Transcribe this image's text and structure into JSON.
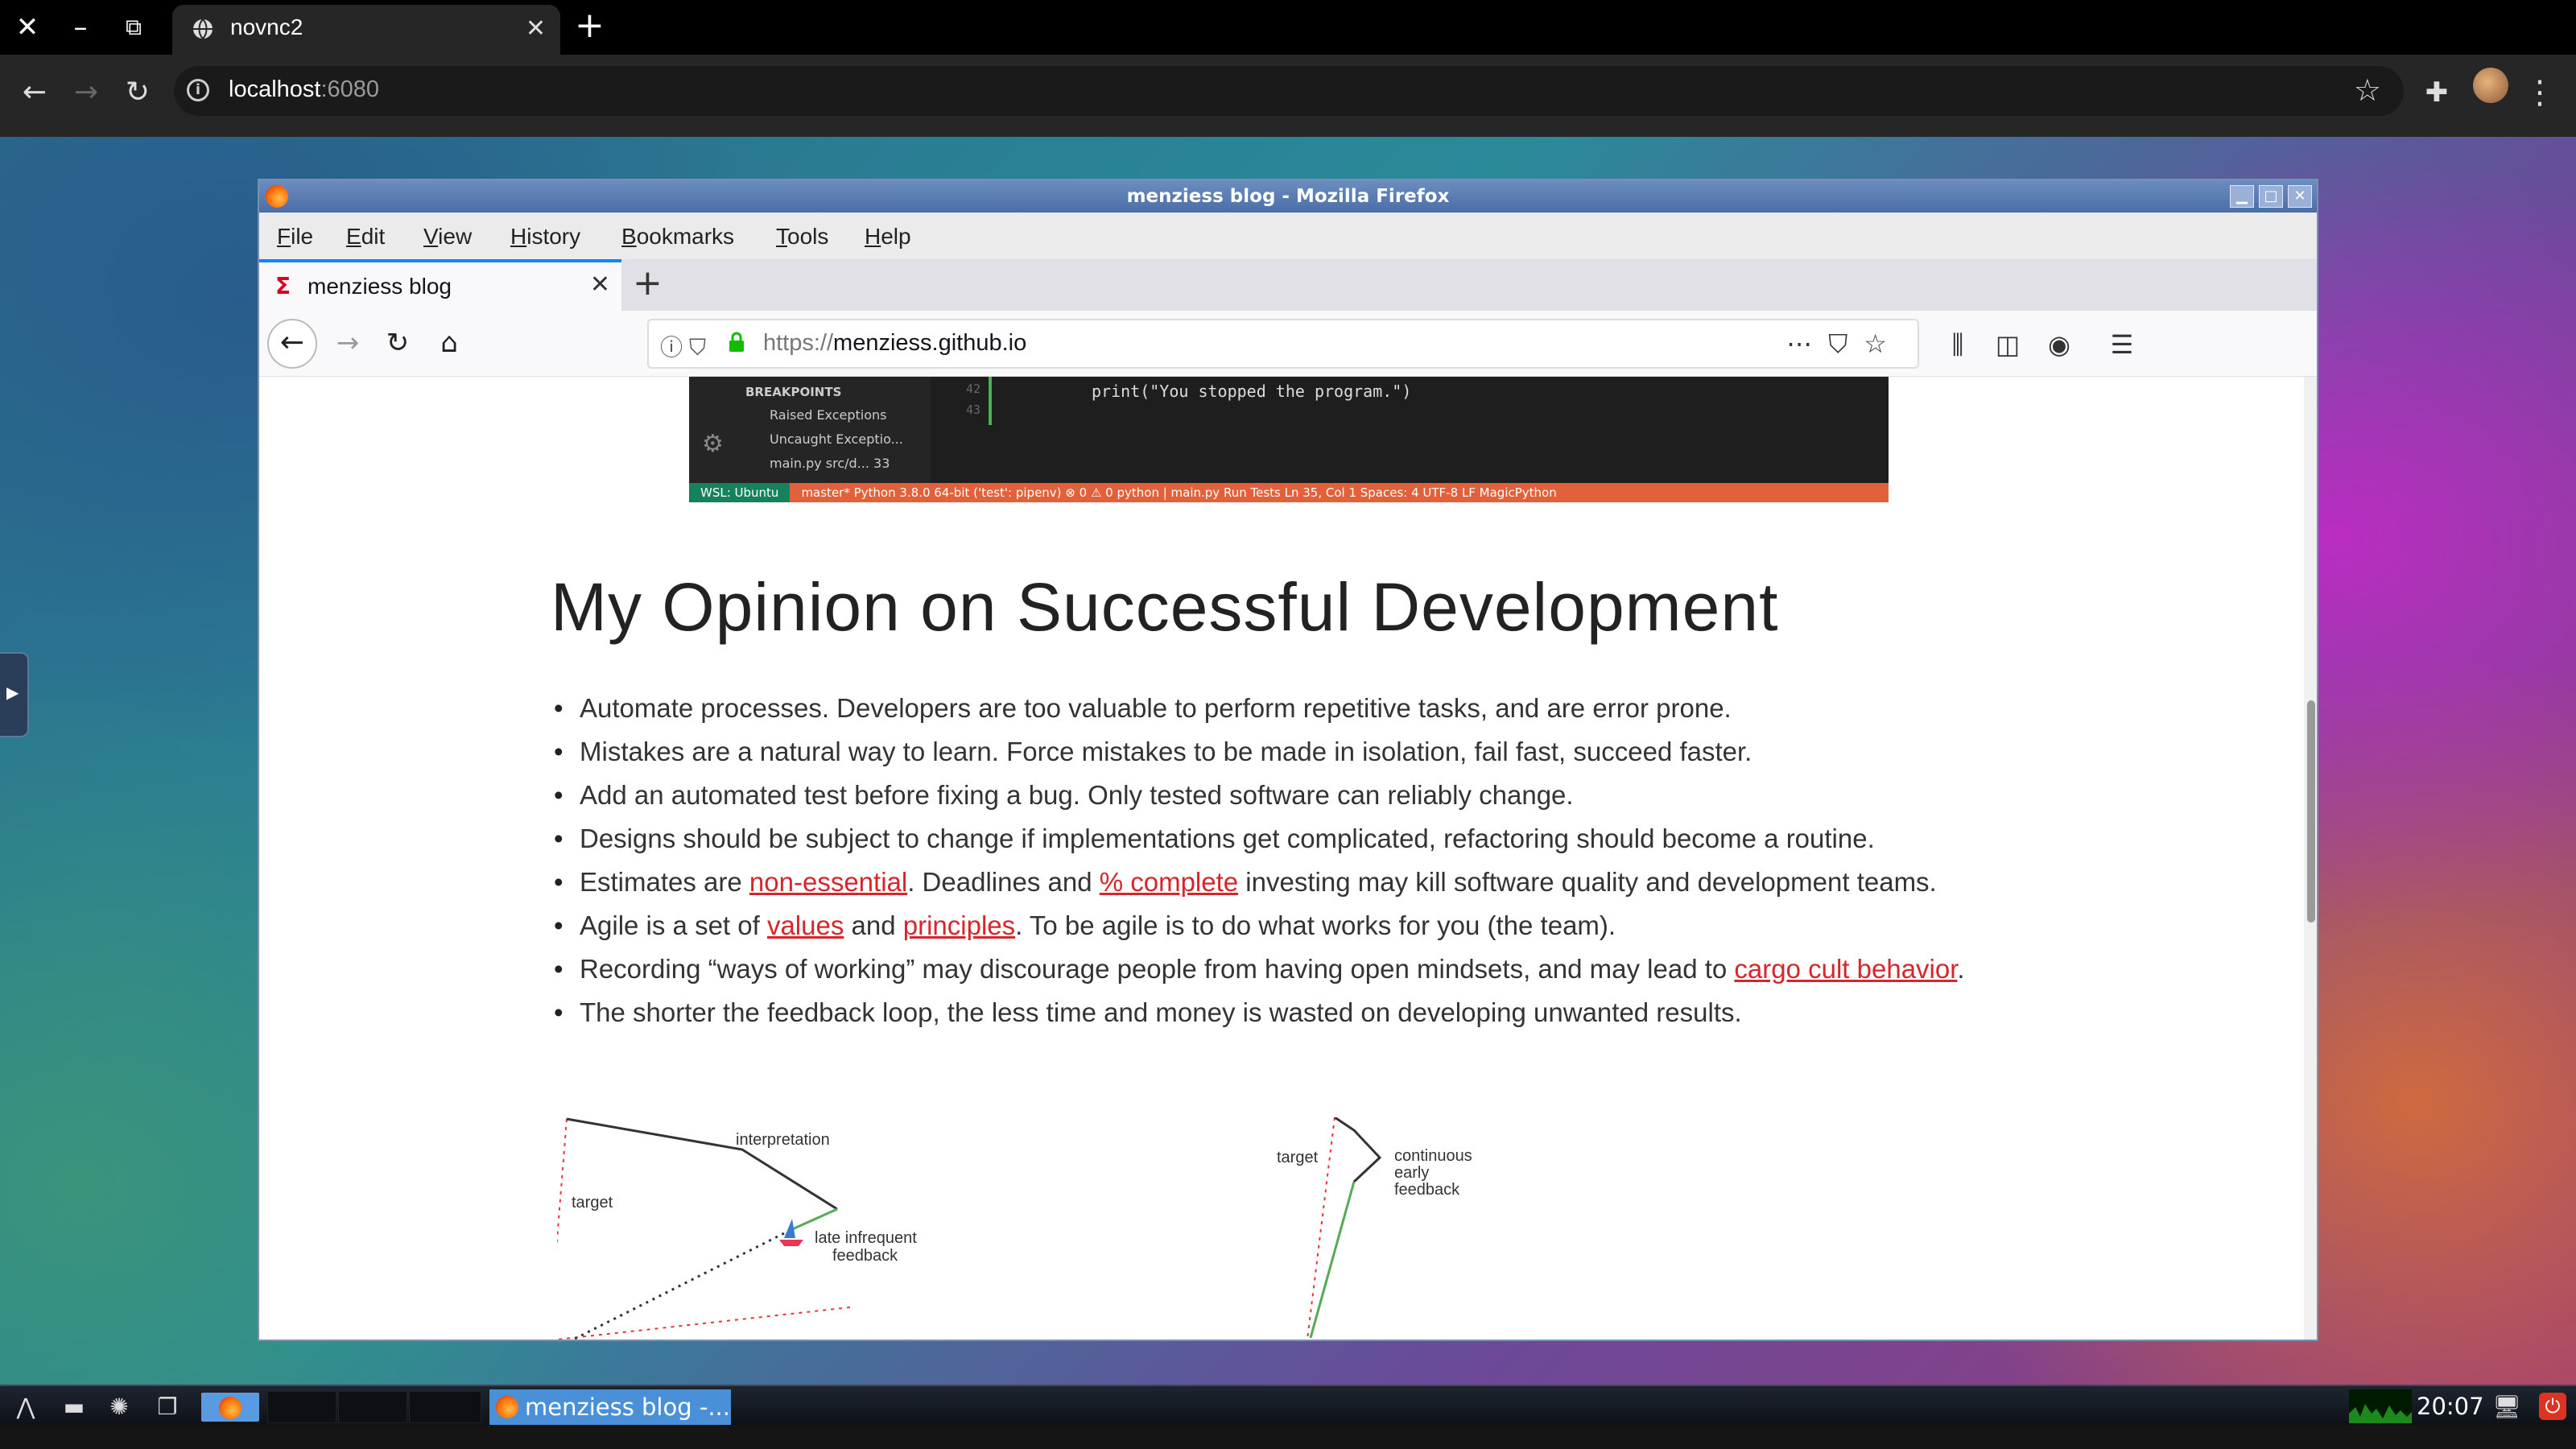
{
  "chrome": {
    "tab_title": "novnc2",
    "url_host": "localhost",
    "url_port": ":6080"
  },
  "firefox": {
    "window_title": "menziess blog - Mozilla Firefox",
    "menu": [
      "File",
      "Edit",
      "View",
      "History",
      "Bookmarks",
      "Tools",
      "Help"
    ],
    "tab_title": "menziess blog",
    "url_scheme": "https://",
    "url_host": "menziess.github.io"
  },
  "code_screenshot": {
    "breakpoints_header": "BREAKPOINTS",
    "breakpoints": [
      "Raised Exceptions",
      "Uncaught Exceptio...",
      "main.py   src/d...   33"
    ],
    "line_numbers": [
      "42",
      "43"
    ],
    "code_line": "print(\"You stopped the program.\")",
    "status_wsl": "WSL: Ubuntu",
    "status_text": "master*    Python 3.8.0 64-bit ('test': pipenv)    ⊗ 0 ⚠ 0    python | main.py    Run Tests                                                        Ln 35, Col 1    Spaces: 4    UTF-8    LF    MagicPython"
  },
  "post": {
    "title": "My Opinion on Successful Development",
    "bullets": {
      "b1": "Automate processes. Developers are too valuable to perform repetitive tasks, and are error prone.",
      "b2": "Mistakes are a natural way to learn. Force mistakes to be made in isolation, fail fast, succeed faster.",
      "b3": "Add an automated test before fixing a bug. Only tested software can reliably change.",
      "b4": "Designs should be subject to change if implementations get complicated, refactoring should become a routine.",
      "b5_a": "Estimates are ",
      "b5_link1": "non-essential",
      "b5_b": ". Deadlines and ",
      "b5_link2": "% complete",
      "b5_c": " investing may kill software quality and development teams.",
      "b6_a": "Agile is a set of ",
      "b6_link1": "values",
      "b6_b": " and ",
      "b6_link2": "principles",
      "b6_c": ". To be agile is to do what works for you (the team).",
      "b7_a": "Recording “ways of working” may discourage people from having open mindsets, and may lead to ",
      "b7_link": "cargo cult behavior",
      "b7_b": ".",
      "b8": "The shorter the feedback loop, the less time and money is wasted on developing unwanted results."
    },
    "diagram": {
      "left_labels": {
        "interpretation": "interpretation",
        "target": "target",
        "late1": "late infrequent",
        "late2": "feedback"
      },
      "right_labels": {
        "target": "target",
        "c1": "continuous",
        "c2": "early",
        "c3": "feedback"
      }
    }
  },
  "taskbar": {
    "task_title": "menziess blog -...",
    "clock": "20:07"
  }
}
